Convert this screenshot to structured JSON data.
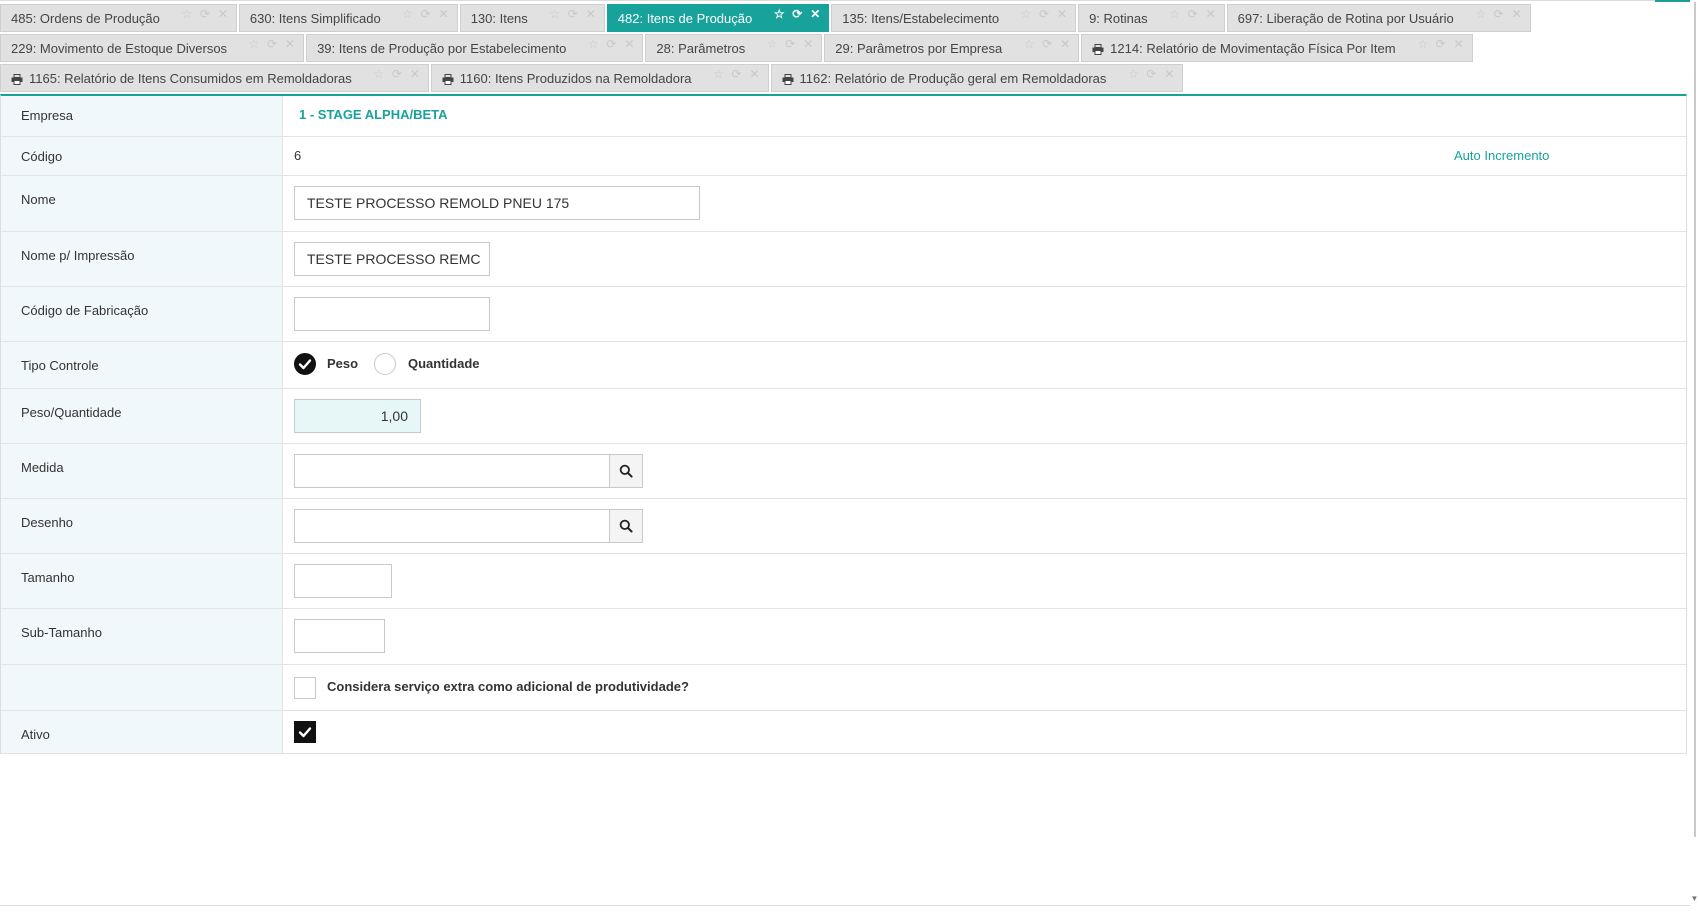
{
  "colors": {
    "accent": "#17a39c",
    "tab_bg": "#e1e1e1",
    "label_bg": "#f1f8fb",
    "check": "#111111"
  },
  "tabs": {
    "row1": [
      {
        "label": "485: Ordens de Produção"
      },
      {
        "label": "630: Itens Simplificado"
      },
      {
        "label": "130: Itens"
      },
      {
        "label": "482: Itens de Produção",
        "active": true
      },
      {
        "label": "135: Itens/Estabelecimento"
      },
      {
        "label": "9: Rotinas"
      },
      {
        "label": "697: Liberação de Rotina por Usuário"
      }
    ],
    "row2": [
      {
        "label": "229: Movimento de Estoque Diversos"
      },
      {
        "label": "39: Itens de Produção por Estabelecimento"
      },
      {
        "label": "28: Parâmetros"
      },
      {
        "label": "29: Parâmetros por Empresa"
      },
      {
        "label": "1214: Relatório de Movimentação Física Por Item",
        "icon": "printer-icon"
      }
    ],
    "row3": [
      {
        "label": "1165: Relatório de Itens Consumidos em Remoldadoras",
        "icon": "printer-icon"
      },
      {
        "label": "1160: Itens Produzidos na Remoldadora",
        "icon": "printer-icon"
      },
      {
        "label": "1162: Relatório de Produção geral em Remoldadoras",
        "icon": "printer-icon"
      }
    ]
  },
  "form": {
    "empresa": {
      "label": "Empresa",
      "value": "1 - STAGE ALPHA/BETA"
    },
    "codigo": {
      "label": "Código",
      "value": "6",
      "note": "Auto Incremento"
    },
    "nome": {
      "label": "Nome",
      "value": "TESTE PROCESSO REMOLD PNEU 175"
    },
    "nome_impressao": {
      "label": "Nome p/ Impressão",
      "value": "TESTE PROCESSO REMC"
    },
    "codigo_fabricacao": {
      "label": "Código de Fabricação",
      "value": ""
    },
    "tipo_controle": {
      "label": "Tipo Controle",
      "options": [
        "Peso",
        "Quantidade"
      ],
      "selected": "Peso"
    },
    "peso_quantidade": {
      "label": "Peso/Quantidade",
      "value": "1,00"
    },
    "medida": {
      "label": "Medida",
      "value": ""
    },
    "desenho": {
      "label": "Desenho",
      "value": ""
    },
    "tamanho": {
      "label": "Tamanho",
      "value": ""
    },
    "sub_tamanho": {
      "label": "Sub-Tamanho",
      "value": ""
    },
    "servico_extra": {
      "label": "",
      "text": "Considera serviço extra como adicional de produtividade?",
      "checked": false
    },
    "ativo": {
      "label": "Ativo",
      "checked": true
    }
  }
}
